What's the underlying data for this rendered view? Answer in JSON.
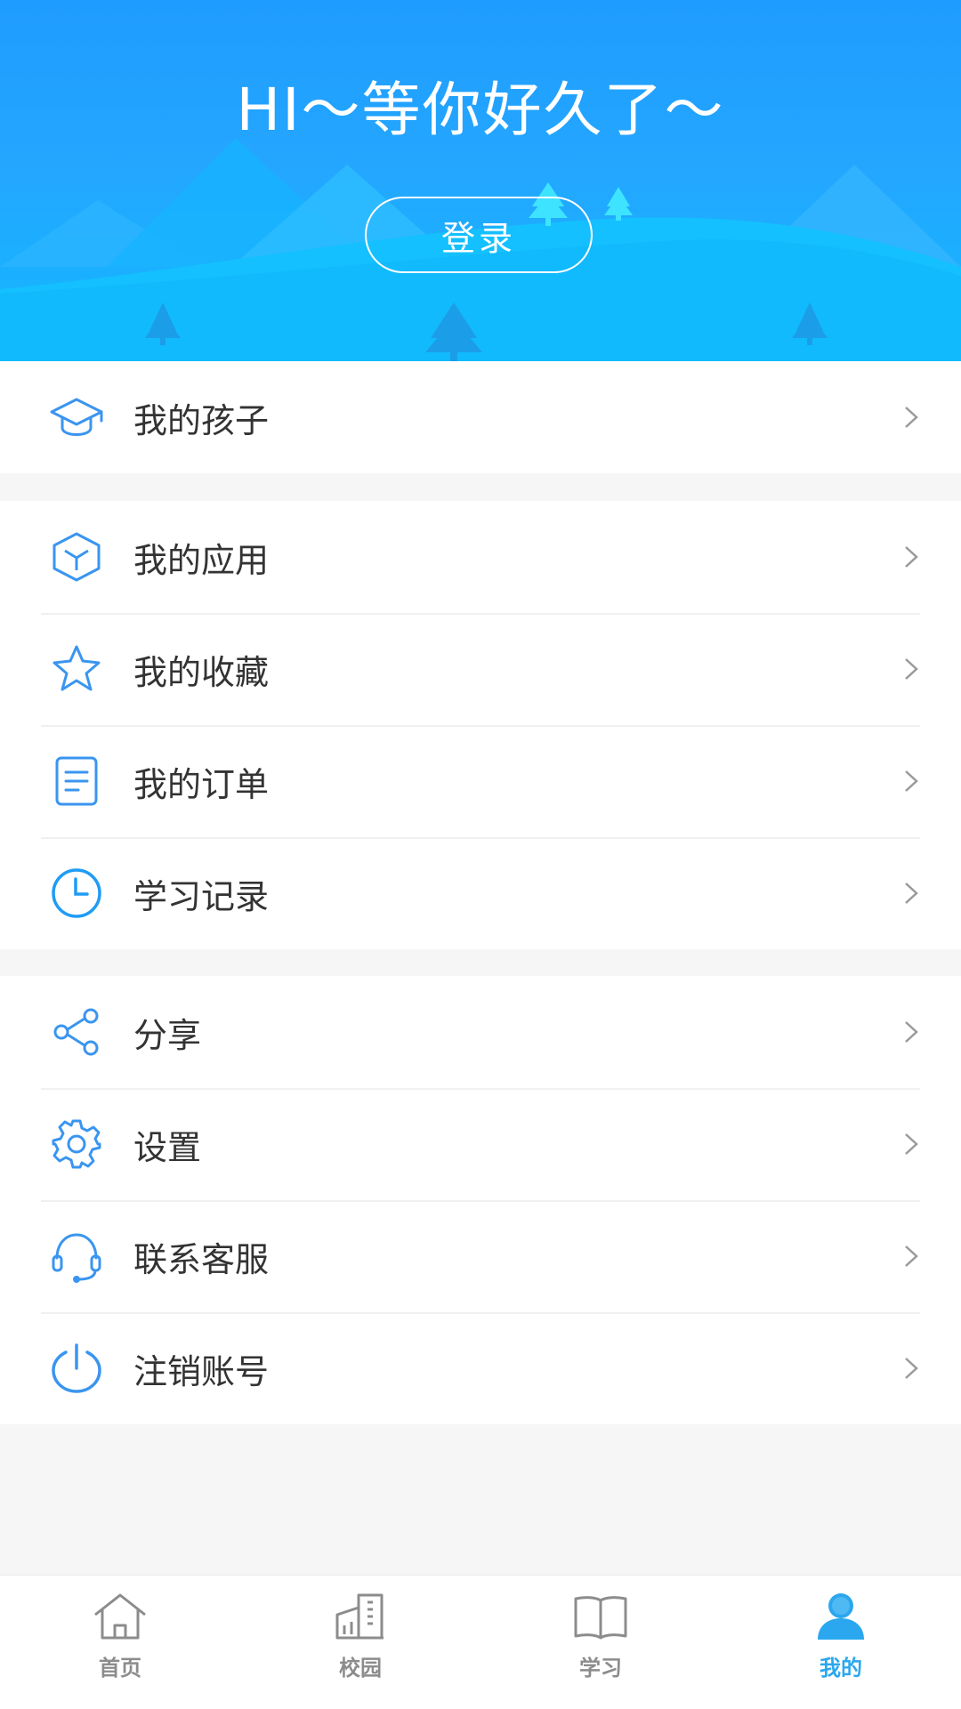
{
  "header": {
    "greeting": "HI～等你好久了～",
    "login_label": "登录"
  },
  "menu_groups": [
    {
      "items": [
        {
          "label": "我的孩子",
          "icon": "graduation-cap-icon"
        }
      ]
    },
    {
      "items": [
        {
          "label": "我的应用",
          "icon": "cube-icon"
        },
        {
          "label": "我的收藏",
          "icon": "star-icon"
        },
        {
          "label": "我的订单",
          "icon": "document-icon"
        },
        {
          "label": "学习记录",
          "icon": "clock-icon"
        }
      ]
    },
    {
      "items": [
        {
          "label": "分享",
          "icon": "share-icon"
        },
        {
          "label": "设置",
          "icon": "gear-icon"
        },
        {
          "label": "联系客服",
          "icon": "headset-icon"
        },
        {
          "label": "注销账号",
          "icon": "power-icon"
        }
      ]
    }
  ],
  "tabbar": {
    "active": "我的",
    "tabs": [
      {
        "label": "首页",
        "icon": "home-icon"
      },
      {
        "label": "校园",
        "icon": "building-icon"
      },
      {
        "label": "学习",
        "icon": "book-icon"
      },
      {
        "label": "我的",
        "icon": "user-icon"
      }
    ]
  },
  "colors": {
    "header_blue": "#1f9cff",
    "icon_blue": "#3a95f0",
    "active_tab": "#2aa7ee",
    "text": "#333333",
    "chevron": "#9a9a9a"
  }
}
